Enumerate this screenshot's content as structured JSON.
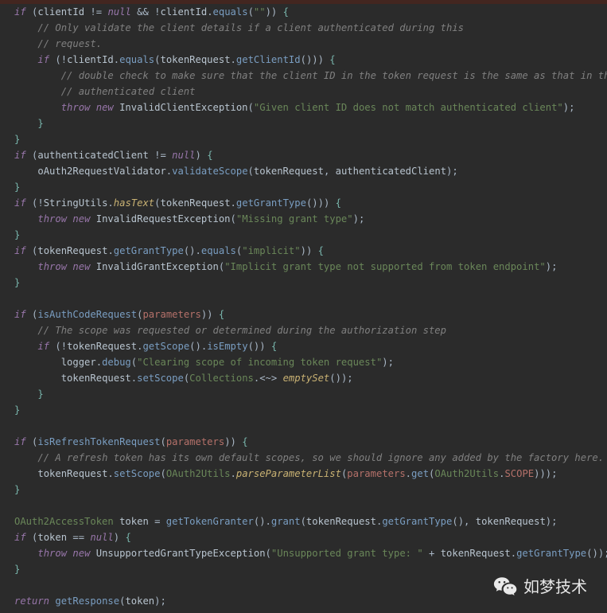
{
  "editor": {
    "background": "#2b2b2b",
    "top_strip_color": "#432620",
    "default_text_color": "#a9b7c6",
    "language": "java",
    "colors": {
      "keyword_italic": "#9876aa",
      "comment": "#808080",
      "string": "#6a8759",
      "method_call": "#7a9ec2",
      "static_method": "#c9b273",
      "type": "#6a8759",
      "parameter": "#b5716a",
      "constant": "#b5716a",
      "brace": "#79b6ad"
    }
  },
  "lines": [
    "if (clientId != null && !clientId.equals(\"\")) {",
    "    // Only validate the client details if a client authenticated during this",
    "    // request.",
    "    if (!clientId.equals(tokenRequest.getClientId())) {",
    "        // double check to make sure that the client ID in the token request is the same as that in the",
    "        // authenticated client",
    "        throw new InvalidClientException(\"Given client ID does not match authenticated client\");",
    "    }",
    "}",
    "if (authenticatedClient != null) {",
    "    oAuth2RequestValidator.validateScope(tokenRequest, authenticatedClient);",
    "}",
    "if (!StringUtils.hasText(tokenRequest.getGrantType())) {",
    "    throw new InvalidRequestException(\"Missing grant type\");",
    "}",
    "if (tokenRequest.getGrantType().equals(\"implicit\")) {",
    "    throw new InvalidGrantException(\"Implicit grant type not supported from token endpoint\");",
    "}",
    "",
    "if (isAuthCodeRequest(parameters)) {",
    "    // The scope was requested or determined during the authorization step",
    "    if (!tokenRequest.getScope().isEmpty()) {",
    "        logger.debug(\"Clearing scope of incoming token request\");",
    "        tokenRequest.setScope(Collections.<~> emptySet());",
    "    }",
    "}",
    "",
    "if (isRefreshTokenRequest(parameters)) {",
    "    // A refresh token has its own default scopes, so we should ignore any added by the factory here.",
    "    tokenRequest.setScope(OAuth2Utils.parseParameterList(parameters.get(OAuth2Utils.SCOPE)));",
    "}",
    "",
    "OAuth2AccessToken token = getTokenGranter().grant(tokenRequest.getGrantType(), tokenRequest);",
    "if (token == null) {",
    "    throw new UnsupportedGrantTypeException(\"Unsupported grant type: \" + tokenRequest.getGrantType());",
    "}",
    "",
    "return getResponse(token);"
  ],
  "tokens": [
    [
      [
        "kwi",
        "if"
      ],
      [
        "punc",
        " ("
      ],
      [
        "pln",
        "clientId"
      ],
      [
        "punc",
        " != "
      ],
      [
        "kwi",
        "null"
      ],
      [
        "punc",
        " && !"
      ],
      [
        "pln",
        "clientId"
      ],
      [
        "punc",
        "."
      ],
      [
        "mth",
        "equals"
      ],
      [
        "punc",
        "("
      ],
      [
        "str",
        "\"\""
      ],
      [
        "punc",
        "))"
      ],
      [
        "brc",
        " {"
      ]
    ],
    [
      [
        "cmt",
        "// Only validate the client details if a client authenticated during this"
      ]
    ],
    [
      [
        "cmt",
        "// request."
      ]
    ],
    [
      [
        "kwi",
        "if"
      ],
      [
        "punc",
        " (!"
      ],
      [
        "pln",
        "clientId"
      ],
      [
        "punc",
        "."
      ],
      [
        "mth",
        "equals"
      ],
      [
        "punc",
        "("
      ],
      [
        "pln",
        "tokenRequest"
      ],
      [
        "punc",
        "."
      ],
      [
        "mth",
        "getClientId"
      ],
      [
        "punc",
        "()))"
      ],
      [
        "brc",
        " {"
      ]
    ],
    [
      [
        "cmt",
        "// double check to make sure that the client ID in the token request is the same as that in the"
      ]
    ],
    [
      [
        "cmt",
        "// authenticated client"
      ]
    ],
    [
      [
        "kwi",
        "throw"
      ],
      [
        "punc",
        " "
      ],
      [
        "kwi",
        "new"
      ],
      [
        "punc",
        " "
      ],
      [
        "pln",
        "InvalidClientException"
      ],
      [
        "punc",
        "("
      ],
      [
        "str",
        "\"Given client ID does not match authenticated client\""
      ],
      [
        "punc",
        ");"
      ]
    ],
    [
      [
        "brc",
        "}"
      ]
    ],
    [
      [
        "brc",
        "}"
      ]
    ],
    [
      [
        "kwi",
        "if"
      ],
      [
        "punc",
        " ("
      ],
      [
        "pln",
        "authenticatedClient"
      ],
      [
        "punc",
        " != "
      ],
      [
        "kwi",
        "null"
      ],
      [
        "punc",
        ")"
      ],
      [
        "brc",
        " {"
      ]
    ],
    [
      [
        "pln",
        "oAuth2RequestValidator"
      ],
      [
        "punc",
        "."
      ],
      [
        "mth",
        "validateScope"
      ],
      [
        "punc",
        "("
      ],
      [
        "pln",
        "tokenRequest"
      ],
      [
        "punc",
        ", "
      ],
      [
        "pln",
        "authenticatedClient"
      ],
      [
        "punc",
        ");"
      ]
    ],
    [
      [
        "brc",
        "}"
      ]
    ],
    [
      [
        "kwi",
        "if"
      ],
      [
        "punc",
        " (!"
      ],
      [
        "pln",
        "StringUtils"
      ],
      [
        "punc",
        "."
      ],
      [
        "smth",
        "hasText"
      ],
      [
        "punc",
        "("
      ],
      [
        "pln",
        "tokenRequest"
      ],
      [
        "punc",
        "."
      ],
      [
        "mth",
        "getGrantType"
      ],
      [
        "punc",
        "()))"
      ],
      [
        "brc",
        " {"
      ]
    ],
    [
      [
        "kwi",
        "throw"
      ],
      [
        "punc",
        " "
      ],
      [
        "kwi",
        "new"
      ],
      [
        "punc",
        " "
      ],
      [
        "pln",
        "InvalidRequestException"
      ],
      [
        "punc",
        "("
      ],
      [
        "str",
        "\"Missing grant type\""
      ],
      [
        "punc",
        ");"
      ]
    ],
    [
      [
        "brc",
        "}"
      ]
    ],
    [
      [
        "kwi",
        "if"
      ],
      [
        "punc",
        " ("
      ],
      [
        "pln",
        "tokenRequest"
      ],
      [
        "punc",
        "."
      ],
      [
        "mth",
        "getGrantType"
      ],
      [
        "punc",
        "()."
      ],
      [
        "mth",
        "equals"
      ],
      [
        "punc",
        "("
      ],
      [
        "str",
        "\"implicit\""
      ],
      [
        "punc",
        "))"
      ],
      [
        "brc",
        " {"
      ]
    ],
    [
      [
        "kwi",
        "throw"
      ],
      [
        "punc",
        " "
      ],
      [
        "kwi",
        "new"
      ],
      [
        "punc",
        " "
      ],
      [
        "pln",
        "InvalidGrantException"
      ],
      [
        "punc",
        "("
      ],
      [
        "str",
        "\"Implicit grant type not supported from token endpoint\""
      ],
      [
        "punc",
        ");"
      ]
    ],
    [
      [
        "brc",
        "}"
      ]
    ],
    [],
    [
      [
        "kwi",
        "if"
      ],
      [
        "punc",
        " ("
      ],
      [
        "mth",
        "isAuthCodeRequest"
      ],
      [
        "punc",
        "("
      ],
      [
        "parm",
        "parameters"
      ],
      [
        "punc",
        "))"
      ],
      [
        "brc",
        " {"
      ]
    ],
    [
      [
        "cmt",
        "// The scope was requested or determined during the authorization step"
      ]
    ],
    [
      [
        "kwi",
        "if"
      ],
      [
        "punc",
        " (!"
      ],
      [
        "pln",
        "tokenRequest"
      ],
      [
        "punc",
        "."
      ],
      [
        "mth",
        "getScope"
      ],
      [
        "punc",
        "()."
      ],
      [
        "mth",
        "isEmpty"
      ],
      [
        "punc",
        "())"
      ],
      [
        "brc",
        " {"
      ]
    ],
    [
      [
        "pln",
        "logger"
      ],
      [
        "punc",
        "."
      ],
      [
        "mth",
        "debug"
      ],
      [
        "punc",
        "("
      ],
      [
        "str",
        "\"Clearing scope of incoming token request\""
      ],
      [
        "punc",
        ");"
      ]
    ],
    [
      [
        "pln",
        "tokenRequest"
      ],
      [
        "punc",
        "."
      ],
      [
        "mth",
        "setScope"
      ],
      [
        "punc",
        "("
      ],
      [
        "typ",
        "Collections"
      ],
      [
        "punc",
        ".<~> "
      ],
      [
        "smth",
        "emptySet"
      ],
      [
        "punc",
        "());"
      ]
    ],
    [
      [
        "brc",
        "}"
      ]
    ],
    [
      [
        "brc",
        "}"
      ]
    ],
    [],
    [
      [
        "kwi",
        "if"
      ],
      [
        "punc",
        " ("
      ],
      [
        "mth",
        "isRefreshTokenRequest"
      ],
      [
        "punc",
        "("
      ],
      [
        "parm",
        "parameters"
      ],
      [
        "punc",
        "))"
      ],
      [
        "brc",
        " {"
      ]
    ],
    [
      [
        "cmt",
        "// A refresh token has its own default scopes, so we should ignore any added by the factory here."
      ]
    ],
    [
      [
        "pln",
        "tokenRequest"
      ],
      [
        "punc",
        "."
      ],
      [
        "mth",
        "setScope"
      ],
      [
        "punc",
        "("
      ],
      [
        "typ",
        "OAuth2Utils"
      ],
      [
        "punc",
        "."
      ],
      [
        "smth",
        "parseParameterList"
      ],
      [
        "punc",
        "("
      ],
      [
        "parm",
        "parameters"
      ],
      [
        "punc",
        "."
      ],
      [
        "mth",
        "get"
      ],
      [
        "punc",
        "("
      ],
      [
        "typ",
        "OAuth2Utils"
      ],
      [
        "punc",
        "."
      ],
      [
        "cnst",
        "SCOPE"
      ],
      [
        "punc",
        ")));"
      ]
    ],
    [
      [
        "brc",
        "}"
      ]
    ],
    [],
    [
      [
        "typ",
        "OAuth2AccessToken"
      ],
      [
        "punc",
        " "
      ],
      [
        "pln",
        "token"
      ],
      [
        "punc",
        " = "
      ],
      [
        "mth",
        "getTokenGranter"
      ],
      [
        "punc",
        "()."
      ],
      [
        "mth",
        "grant"
      ],
      [
        "punc",
        "("
      ],
      [
        "pln",
        "tokenRequest"
      ],
      [
        "punc",
        "."
      ],
      [
        "mth",
        "getGrantType"
      ],
      [
        "punc",
        "(), "
      ],
      [
        "pln",
        "tokenRequest"
      ],
      [
        "punc",
        ");"
      ]
    ],
    [
      [
        "kwi",
        "if"
      ],
      [
        "punc",
        " ("
      ],
      [
        "pln",
        "token"
      ],
      [
        "punc",
        " == "
      ],
      [
        "kwi",
        "null"
      ],
      [
        "punc",
        ")"
      ],
      [
        "brc",
        " {"
      ]
    ],
    [
      [
        "kwi",
        "throw"
      ],
      [
        "punc",
        " "
      ],
      [
        "kwi",
        "new"
      ],
      [
        "punc",
        " "
      ],
      [
        "pln",
        "UnsupportedGrantTypeException"
      ],
      [
        "punc",
        "("
      ],
      [
        "str",
        "\"Unsupported grant type: \""
      ],
      [
        "punc",
        " + "
      ],
      [
        "pln",
        "tokenRequest"
      ],
      [
        "punc",
        "."
      ],
      [
        "mth",
        "getGrantType"
      ],
      [
        "punc",
        "());"
      ]
    ],
    [
      [
        "brc",
        "}"
      ]
    ],
    [],
    [
      [
        "kwi",
        "return"
      ],
      [
        "punc",
        " "
      ],
      [
        "mth",
        "getResponse"
      ],
      [
        "punc",
        "("
      ],
      [
        "pln",
        "token"
      ],
      [
        "punc",
        ");"
      ]
    ]
  ],
  "indents": [
    0,
    1,
    1,
    1,
    2,
    2,
    2,
    1,
    0,
    0,
    1,
    0,
    0,
    1,
    0,
    0,
    1,
    0,
    0,
    0,
    1,
    1,
    2,
    2,
    1,
    0,
    0,
    0,
    1,
    1,
    0,
    0,
    0,
    0,
    1,
    0,
    0,
    0
  ],
  "watermark": {
    "icon": "wechat-icon",
    "text": "如梦技术",
    "text_color": "#e8e8e8"
  }
}
